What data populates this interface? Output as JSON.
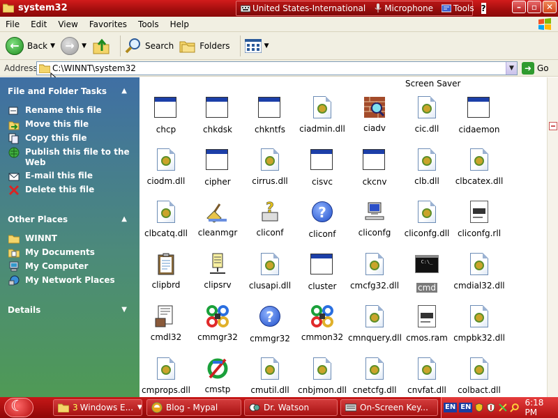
{
  "window": {
    "title": "system32",
    "langbar": {
      "language": "United States-International",
      "microphone": "Microphone",
      "tools": "Tools",
      "help": "?"
    }
  },
  "menu": [
    "File",
    "Edit",
    "View",
    "Favorites",
    "Tools",
    "Help"
  ],
  "toolbar": {
    "back": "Back",
    "search": "Search",
    "folders": "Folders"
  },
  "address": {
    "label": "Address",
    "value": "C:\\WINNT\\system32",
    "go": "Go"
  },
  "left_pane": {
    "file_tasks": {
      "header": "File and Folder Tasks",
      "items": [
        {
          "label": "Rename this file",
          "icon": "rename-icon"
        },
        {
          "label": "Move this file",
          "icon": "move-icon"
        },
        {
          "label": "Copy this file",
          "icon": "copy-icon"
        },
        {
          "label": "Publish this file to the Web",
          "icon": "publish-icon"
        },
        {
          "label": "E-mail this file",
          "icon": "email-icon"
        },
        {
          "label": "Delete this file",
          "icon": "delete-icon"
        }
      ]
    },
    "other_places": {
      "header": "Other Places",
      "items": [
        {
          "label": "WINNT",
          "icon": "folder-icon"
        },
        {
          "label": "My Documents",
          "icon": "my-documents-icon"
        },
        {
          "label": "My Computer",
          "icon": "my-computer-icon"
        },
        {
          "label": "My Network Places",
          "icon": "network-places-icon"
        }
      ]
    },
    "details": {
      "header": "Details"
    }
  },
  "content": {
    "top_partial_label": "Screen Saver",
    "files": [
      {
        "name": "chcp",
        "icon": "exe"
      },
      {
        "name": "chkdsk",
        "icon": "exe"
      },
      {
        "name": "chkntfs",
        "icon": "exe"
      },
      {
        "name": "ciadmin.dll",
        "icon": "dll"
      },
      {
        "name": "ciadv",
        "icon": "brick"
      },
      {
        "name": "cic.dll",
        "icon": "dll"
      },
      {
        "name": "cidaemon",
        "icon": "exe"
      },
      {
        "name": "ciodm.dll",
        "icon": "dll"
      },
      {
        "name": "cipher",
        "icon": "exe"
      },
      {
        "name": "cirrus.dll",
        "icon": "dll"
      },
      {
        "name": "cisvc",
        "icon": "exe"
      },
      {
        "name": "ckcnv",
        "icon": "exe"
      },
      {
        "name": "clb.dll",
        "icon": "dll"
      },
      {
        "name": "clbcatex.dll",
        "icon": "dll"
      },
      {
        "name": "clbcatq.dll",
        "icon": "dll"
      },
      {
        "name": "cleanmgr",
        "icon": "broom"
      },
      {
        "name": "cliconf",
        "icon": "question"
      },
      {
        "name": "cliconf",
        "icon": "help"
      },
      {
        "name": "cliconfg",
        "icon": "computer"
      },
      {
        "name": "cliconfg.dll",
        "icon": "dll"
      },
      {
        "name": "cliconfg.rll",
        "icon": "ini"
      },
      {
        "name": "clipbrd",
        "icon": "clipboard"
      },
      {
        "name": "clipsrv",
        "icon": "clipsrv"
      },
      {
        "name": "clusapi.dll",
        "icon": "dll"
      },
      {
        "name": "cluster",
        "icon": "exe"
      },
      {
        "name": "cmcfg32.dll",
        "icon": "dll"
      },
      {
        "name": "cmd",
        "icon": "cmd",
        "selected": true
      },
      {
        "name": "cmdial32.dll",
        "icon": "dll"
      },
      {
        "name": "cmdl32",
        "icon": "phone"
      },
      {
        "name": "cmmgr32",
        "icon": "clover"
      },
      {
        "name": "cmmgr32",
        "icon": "help"
      },
      {
        "name": "cmmon32",
        "icon": "clover"
      },
      {
        "name": "cmnquery.dll",
        "icon": "dll"
      },
      {
        "name": "cmos.ram",
        "icon": "ini"
      },
      {
        "name": "cmpbk32.dll",
        "icon": "dll"
      },
      {
        "name": "cmprops.dll",
        "icon": "dll"
      },
      {
        "name": "cmstp",
        "icon": "cmstp"
      },
      {
        "name": "cmutil.dll",
        "icon": "dll"
      },
      {
        "name": "cnbjmon.dll",
        "icon": "dll"
      },
      {
        "name": "cnetcfg.dll",
        "icon": "dll"
      },
      {
        "name": "cnvfat.dll",
        "icon": "dll"
      },
      {
        "name": "colbact.dll",
        "icon": "dll"
      }
    ]
  },
  "taskbar": {
    "buttons": [
      {
        "label": "Windows E...",
        "count": "3"
      },
      {
        "label": "Blog - Mypal"
      },
      {
        "label": "Dr. Watson"
      },
      {
        "label": "On-Screen Key..."
      }
    ],
    "tray": {
      "lang1": "EN",
      "lang2": "EN",
      "clock": "6:18 PM"
    }
  },
  "colors": {
    "titlebar": "#b31414",
    "taskbar": "#b31414",
    "selection": "#7a7a7a"
  }
}
